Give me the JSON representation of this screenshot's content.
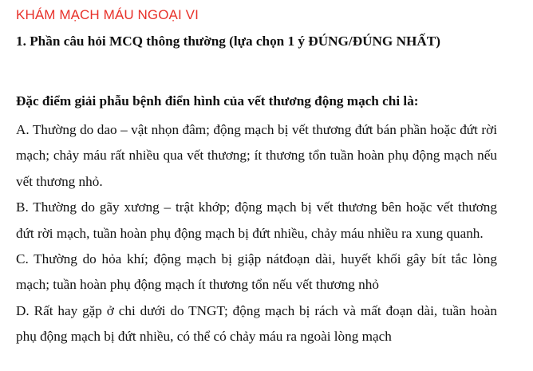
{
  "document": {
    "title": "KHÁM MẠCH MÁU NGOẠI VI",
    "section_heading": "1. Phần câu hỏi MCQ thông thường (lựa chọn 1 ý ĐÚNG/ĐÚNG NHẤT)",
    "question": "Đặc điểm giải phẫu bệnh điển hình của vết thương động mạch chi là:",
    "options": [
      {
        "text": "A. Thường do dao – vật nhọn đâm; động mạch bị vết thương đứt bán phần hoặc đứt rời mạch; chảy máu rất nhiều qua vết thương; ít thương tổn tuần hoàn phụ động mạch nếu vết thương nhỏ."
      },
      {
        "text": "B. Thường do gãy xương – trật khớp; động mạch bị vết thương bên hoặc vết thương đứt rời mạch, tuần hoàn phụ động mạch bị đứt nhiều, chảy máu nhiều ra xung quanh."
      },
      {
        "text": "C. Thường do hỏa khí; động mạch bị giập nátđoạn dài, huyết khối gây bít tắc lòng mạch; tuần hoàn phụ động mạch ít thương tổn nếu vết thương nhỏ"
      },
      {
        "text": "D. Rất hay gặp ở chi dưới do TNGT; động mạch bị rách và mất đoạn dài, tuần hoàn phụ động mạch bị đứt nhiều, có thể có chảy máu ra ngoài lòng mạch"
      }
    ]
  }
}
